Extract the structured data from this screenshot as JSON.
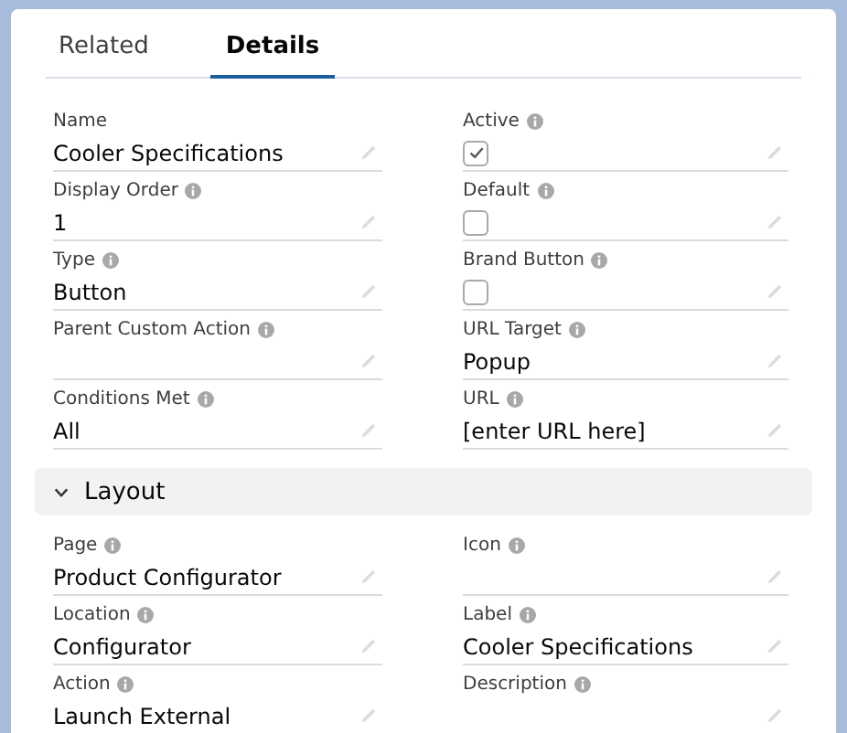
{
  "tabs": [
    {
      "label": "Related",
      "selected": false
    },
    {
      "label": "Details",
      "selected": true
    }
  ],
  "fields": [
    {
      "label": "Name",
      "info": false,
      "kind": "text",
      "value": "Cooler Specifications"
    },
    {
      "label": "Active",
      "info": true,
      "kind": "checkbox",
      "checked": true
    },
    {
      "label": "Display Order",
      "info": true,
      "kind": "text",
      "value": "1"
    },
    {
      "label": "Default",
      "info": true,
      "kind": "checkbox",
      "checked": false
    },
    {
      "label": "Type",
      "info": true,
      "kind": "text",
      "value": "Button"
    },
    {
      "label": "Brand Button",
      "info": true,
      "kind": "checkbox",
      "checked": false
    },
    {
      "label": "Parent Custom Action",
      "info": true,
      "kind": "text"
    },
    {
      "label": "URL Target",
      "info": true,
      "kind": "text",
      "value": "Popup"
    },
    {
      "label": "Conditions Met",
      "info": true,
      "kind": "text",
      "value": "All"
    },
    {
      "label": "URL",
      "info": true,
      "kind": "text",
      "value": "[enter URL here]"
    }
  ],
  "section": {
    "title": "Layout",
    "expanded": true,
    "fields": [
      {
        "label": "Page",
        "info": true,
        "kind": "text",
        "value": "Product Configurator"
      },
      {
        "label": "Icon",
        "info": true,
        "kind": "text"
      },
      {
        "label": "Location",
        "info": true,
        "kind": "text",
        "value": "Configurator"
      },
      {
        "label": "Label",
        "info": true,
        "kind": "text",
        "value": "Cooler Specifications"
      },
      {
        "label": "Action",
        "info": true,
        "kind": "text",
        "value": "Launch External"
      },
      {
        "label": "Description",
        "info": true,
        "kind": "text"
      }
    ]
  }
}
